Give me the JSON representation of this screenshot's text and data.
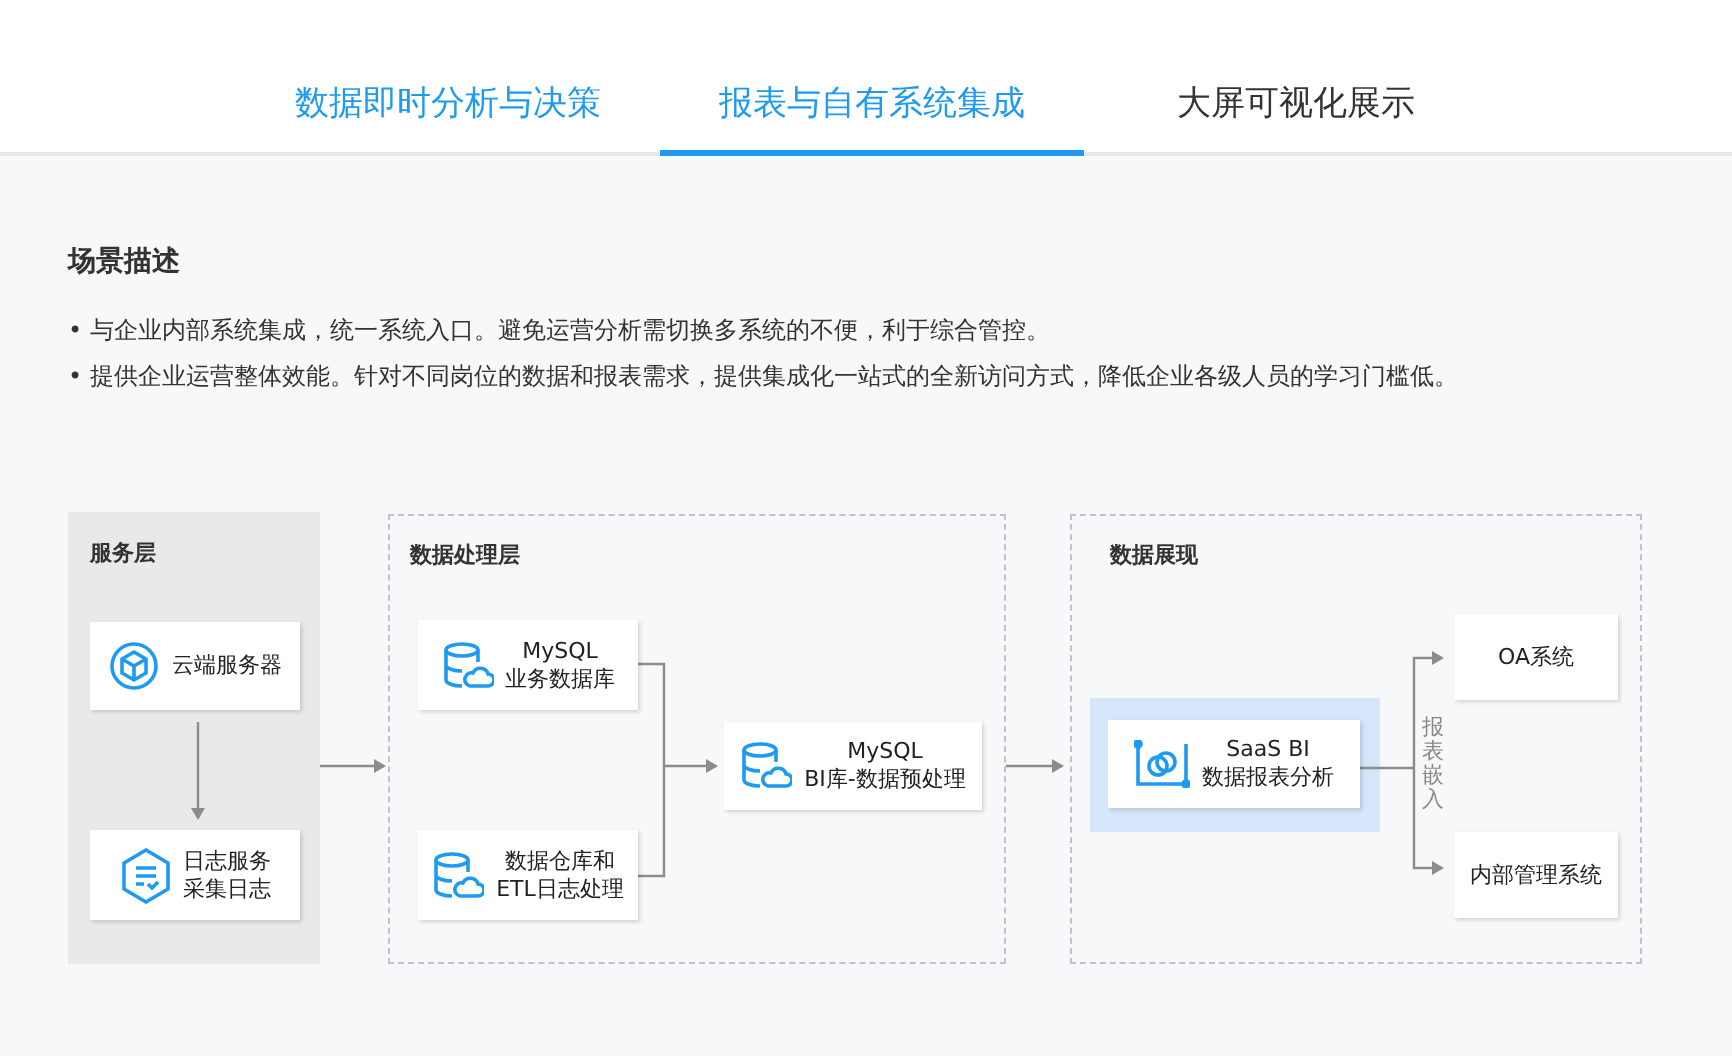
{
  "tabs": [
    {
      "label": "数据即时分析与决策",
      "selected": false,
      "color": "#1e9bf0"
    },
    {
      "label": "报表与自有系统集成",
      "selected": true,
      "color": "#1e9bf0"
    },
    {
      "label": "大屏可视化展示",
      "selected": false,
      "color": "#333333"
    }
  ],
  "scenario": {
    "title": "场景描述",
    "bullets": [
      "• 与企业内部系统集成，统一系统入口。避免运营分析需切换多系统的不便，利于综合管控。",
      "• 提供企业运营整体效能。针对不同岗位的数据和报表需求，提供集成化一站式的全新访问方式，降低企业各级人员的学习门槛低。"
    ]
  },
  "diagram": {
    "layers": [
      {
        "kind": "solid",
        "title": "服务层"
      },
      {
        "kind": "dashed",
        "title": "数据处理层"
      },
      {
        "kind": "dashed",
        "title": "数据展现"
      }
    ],
    "nodes": [
      {
        "kind": "cloud",
        "lines": [
          "云端服务器"
        ]
      },
      {
        "kind": "log",
        "lines": [
          "日志服务",
          "采集日志"
        ]
      },
      {
        "kind": "db",
        "lines": [
          "MySQL",
          "业务数据库"
        ]
      },
      {
        "kind": "db",
        "lines": [
          "数据仓库和",
          "ETL日志处理"
        ]
      },
      {
        "kind": "db",
        "lines": [
          "MySQL",
          "BI库-数据预处理"
        ]
      },
      {
        "kind": "bi",
        "lines": [
          "SaaS BI",
          "数据报表分析"
        ]
      },
      {
        "kind": "plain",
        "lines": [
          "OA系统"
        ]
      },
      {
        "kind": "plain",
        "lines": [
          "内部管理系统"
        ]
      }
    ],
    "embed_label": "报表嵌入"
  }
}
